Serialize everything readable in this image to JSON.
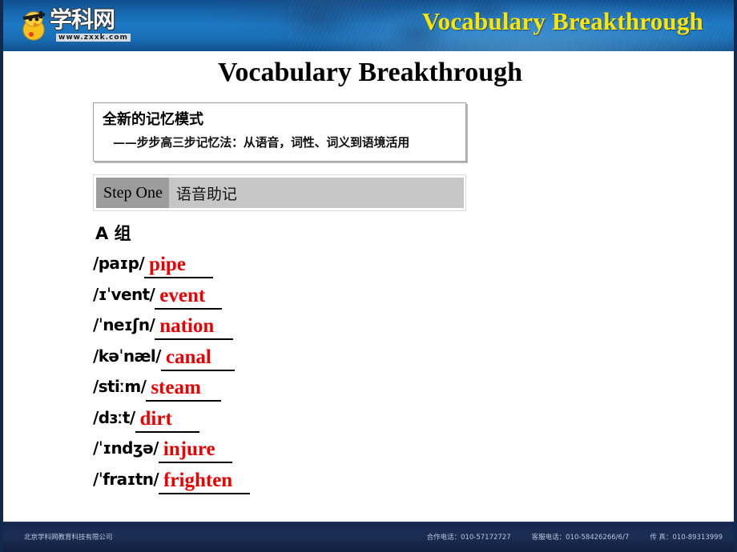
{
  "header": {
    "logo_text": "学科网",
    "logo_url": "www.zxxk.com",
    "banner_title": "Vocabulary Breakthrough",
    "banner_color": "#1c79c4",
    "banner_title_color": "#ffe400"
  },
  "slide": {
    "title": "Vocabulary Breakthrough"
  },
  "mode_box": {
    "title": "全新的记忆模式",
    "subtitle": "——步步高三步记忆法：从语音，词性、词义到语境活用"
  },
  "step": {
    "label": "Step One",
    "text": "语音助记",
    "label_bg": "#9c9c9c",
    "text_bg": "#c6c6c6"
  },
  "group": {
    "heading": "A 组"
  },
  "answer_color": "#ee0000",
  "words": [
    {
      "phonetic": "/paɪp/",
      "answer": "pipe",
      "blank_width": 86
    },
    {
      "phonetic": "/ɪˈvent/",
      "answer": "event",
      "blank_width": 84
    },
    {
      "phonetic": "/ˈneɪʃn/",
      "answer": "nation",
      "blank_width": 98
    },
    {
      "phonetic": "/kəˈnæl/",
      "answer": "canal",
      "blank_width": 92
    },
    {
      "phonetic": "/stiːm/",
      "answer": "steam",
      "blank_width": 94
    },
    {
      "phonetic": "/dɜːt/",
      "answer": "dirt",
      "blank_width": 80
    },
    {
      "phonetic": "/ˈɪndʒə/",
      "answer": "injure",
      "blank_width": 92
    },
    {
      "phonetic": "/ˈfraɪtn/",
      "answer": "frighten",
      "blank_width": 114
    }
  ],
  "footer": {
    "company": "北京学科网教育科技有限公司",
    "contacts": [
      "合作电话：010-57172727",
      "客服电话：010-58426266/6/7",
      "传  真：010-89313999"
    ]
  }
}
